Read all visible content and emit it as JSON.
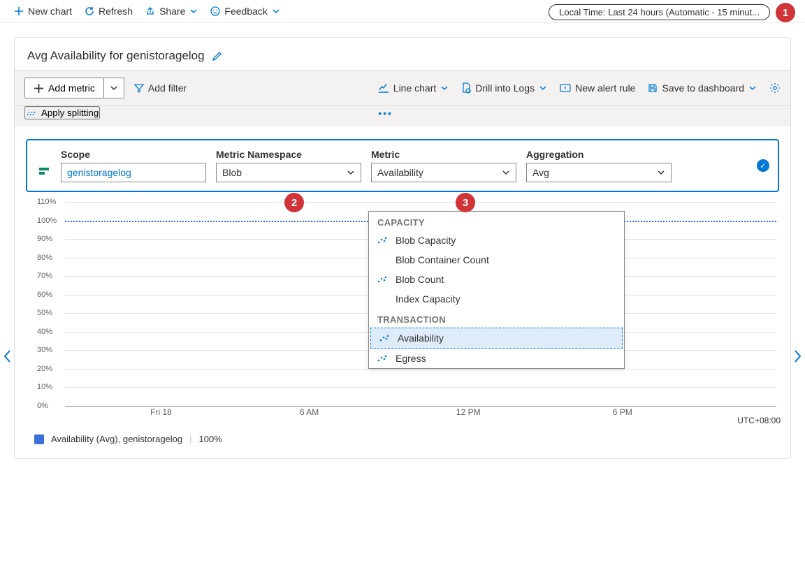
{
  "toolbar": {
    "new_chart": "New chart",
    "refresh": "Refresh",
    "share": "Share",
    "feedback": "Feedback",
    "time_pill": "Local Time: Last 24 hours (Automatic - 15 minut..."
  },
  "badges": {
    "b1": "1",
    "b2": "2",
    "b3": "3"
  },
  "chart": {
    "title": "Avg Availability for genistoragelog",
    "add_metric": "Add metric",
    "add_filter": "Add filter",
    "apply_splitting": "Apply splitting",
    "line_chart": "Line chart",
    "drill_logs": "Drill into Logs",
    "new_alert": "New alert rule",
    "save_dashboard": "Save to dashboard"
  },
  "metric_row": {
    "scope_label": "Scope",
    "scope_value": "genistoragelog",
    "ns_label": "Metric Namespace",
    "ns_value": "Blob",
    "metric_label": "Metric",
    "metric_value": "Availability",
    "agg_label": "Aggregation",
    "agg_value": "Avg"
  },
  "dropdown": {
    "group1": "CAPACITY",
    "items1": [
      "Blob Capacity",
      "Blob Container Count",
      "Blob Count",
      "Index Capacity"
    ],
    "group2": "TRANSACTION",
    "items2": [
      "Availability",
      "Egress"
    ]
  },
  "chart_data": {
    "type": "line",
    "title": "Avg Availability for genistoragelog",
    "ylabel": "%",
    "ylim": [
      0,
      110
    ],
    "y_ticks": [
      "110%",
      "100%",
      "90%",
      "80%",
      "70%",
      "60%",
      "50%",
      "40%",
      "30%",
      "20%",
      "10%",
      "0%"
    ],
    "x_ticks": [
      "Fri 18",
      "6 AM",
      "12 PM",
      "6 PM"
    ],
    "timezone": "UTC+08:00",
    "series": [
      {
        "name": "Availability (Avg), genistoragelog",
        "summary_value": "100%",
        "constant_value_pct": 100
      }
    ]
  },
  "legend": {
    "label": "Availability (Avg), genistoragelog",
    "value": "100%"
  }
}
